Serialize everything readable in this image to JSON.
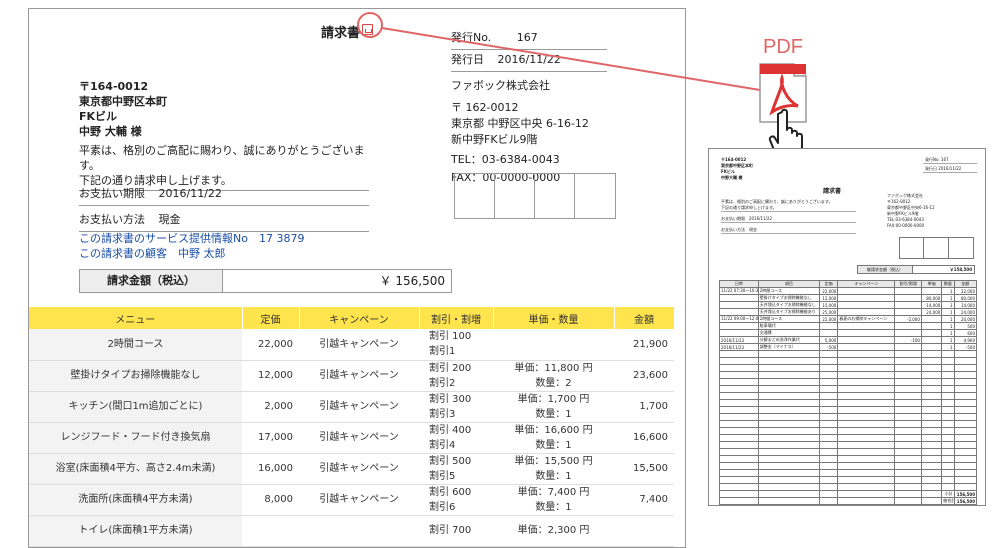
{
  "invoice": {
    "title": "請求書",
    "issue_no_label": "発行No.",
    "issue_no": "167",
    "issue_date_label": "発行日",
    "issue_date": "2016/11/22",
    "recipient": {
      "postal": "〒164-0012",
      "address": "東京都中野区本町",
      "building": "FKビル",
      "name": "中野 大輔 様"
    },
    "greeting_1": "平素は、格別のご高配に賜わり、誠にありがとうございます。",
    "greeting_2": "下記の通り請求申し上げます。",
    "due_label": "お支払い期限",
    "due_date": "2016/11/22",
    "method_label": "お支払い方法",
    "method": "現金",
    "service_link": "この請求書のサービス提供情報No　17 3879",
    "customer_link": "この請求書の顧客　中野 太郎",
    "sender": {
      "company": "ファボック株式会社",
      "postal": "〒 162-0012",
      "address": "東京都 中野区中央 6-16-12",
      "building": "新中野FKビル9階",
      "tel": "TEL：03-6384-0043",
      "fax": "FAX：00-0000-0000"
    },
    "total_label": "請求金額（税込）",
    "total": "￥ 156,500",
    "columns": [
      "メニュー",
      "定価",
      "キャンペーン",
      "割引・割増",
      "単価・数量",
      "金額"
    ],
    "rows": [
      {
        "menu": "2時間コース",
        "price": "22,000",
        "campaign": "引越キャンペーン",
        "disc1": "割引 100",
        "disc2": "割引1",
        "unit": "",
        "qty": "",
        "amount": "21,900"
      },
      {
        "menu": "壁掛けタイプお掃除機能なし",
        "price": "12,000",
        "campaign": "引越キャンペーン",
        "disc1": "割引 200",
        "disc2": "割引2",
        "unit": "単価：11,800 円",
        "qty": "数量：2",
        "amount": "23,600"
      },
      {
        "menu": "キッチン(間口1m追加ごとに)",
        "price": "2,000",
        "campaign": "引越キャンペーン",
        "disc1": "割引 300",
        "disc2": "割引3",
        "unit": "単価：1,700 円",
        "qty": "数量：1",
        "amount": "1,700"
      },
      {
        "menu": "レンジフード・フード付き換気扇",
        "price": "17,000",
        "campaign": "引越キャンペーン",
        "disc1": "割引 400",
        "disc2": "割引4",
        "unit": "単価：16,600 円",
        "qty": "数量：1",
        "amount": "16,600"
      },
      {
        "menu": "浴室(床面積4平方、高さ2.4m未満)",
        "price": "16,000",
        "campaign": "引越キャンペーン",
        "disc1": "割引 500",
        "disc2": "割引5",
        "unit": "単価：15,500 円",
        "qty": "数量：1",
        "amount": "15,500"
      },
      {
        "menu": "洗面所(床面積4平方未満)",
        "price": "8,000",
        "campaign": "引越キャンペーン",
        "disc1": "割引 600",
        "disc2": "割引6",
        "unit": "単価：7,400 円",
        "qty": "数量：1",
        "amount": "7,400"
      },
      {
        "menu": "トイレ(床面積1平方未満)",
        "price": "",
        "campaign": "",
        "disc1": "割引 700",
        "disc2": "",
        "unit": "単価：2,300 円",
        "qty": "",
        "amount": ""
      }
    ]
  },
  "pdf_label": "PDF",
  "thumb": {
    "postal": "〒164-0012",
    "address": "東京都中野区本町",
    "building": "FKビル",
    "name": "中野大輔 様",
    "issue_no": "発行No. 167",
    "issue_date": "発行日 2016/11/22",
    "title": "請求書",
    "greeting_1": "平素は、格別のご高配に賜わり、誠にありがとうございます。",
    "greeting_2": "下記の通り請求申し上げます。",
    "due": "お支払い期限　2016/11/22",
    "method": "お支払い方法　現金",
    "company": "ファボック株式会社",
    "s_postal": "〒162-0012",
    "s_address": "東京都中野区中央6-16-12",
    "s_building": "新中野FKビル9階",
    "s_tel": "TEL:03-6384-0043",
    "s_fax": "FAX:00-0000-0000",
    "total_label": "御請求金額（税込）",
    "total": "￥158,500",
    "columns": [
      "日時",
      "項目",
      "定価",
      "キャンペーン",
      "割引/割増",
      "単価",
      "数量",
      "金額"
    ],
    "rows": [
      [
        "11/22 07:30〜10:30",
        "2時間コース",
        "22,000",
        "",
        "",
        "",
        "1",
        "22,000"
      ],
      [
        "",
        "壁掛けタイプお掃除機能なし",
        "12,000",
        "",
        "",
        "80,000",
        "1",
        "80,000"
      ],
      [
        "",
        "天井埋込タイプお掃除機能なし",
        "15,000",
        "",
        "",
        "14,000",
        "1",
        "14,000"
      ],
      [
        "",
        "天井埋込タイプお掃除機能あり",
        "25,000",
        "",
        "",
        "24,000",
        "1",
        "24,000"
      ],
      [
        "11/22 09:00〜12:00",
        "2時間コース",
        "22,000",
        "春夏のお掃除キャンペーン",
        "-2,000",
        "",
        "1",
        "20,000"
      ],
      [
        "",
        "駐車場代",
        "",
        "",
        "",
        "",
        "1",
        "500"
      ],
      [
        "",
        "交通費",
        "",
        "",
        "",
        "",
        "1",
        "600"
      ],
      [
        "2016/11/23",
        "分解まとめ洗浄作業代",
        "5,000",
        "",
        "-100",
        "",
        "1",
        "4,900"
      ],
      [
        "2016/11/23",
        "調整金（マイナス）",
        "-500",
        "",
        "",
        "",
        "1",
        "-500"
      ]
    ],
    "subtotal_label": "小計",
    "subtotal": "156,500",
    "grand_label": "総合計",
    "grand_total": "156,500"
  }
}
